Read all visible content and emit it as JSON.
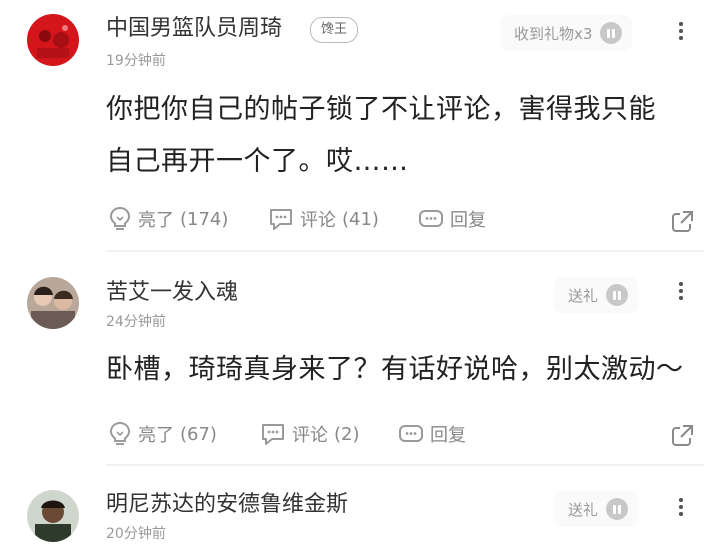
{
  "comments": [
    {
      "username": "中国男篮队员周琦",
      "badge": "馋王",
      "timestamp": "19分钟前",
      "gift_label": "收到礼物x3",
      "body_lines": [
        "你把你自己的帖子锁了不让评论，害得我只能",
        "自己再开一个了。哎……"
      ],
      "likes_label": "亮了",
      "likes_count": "(174)",
      "comments_label": "评论",
      "comments_count": "(41)",
      "reply_label": "回复"
    },
    {
      "username": "苦艾一发入魂",
      "timestamp": "24分钟前",
      "gift_label": "送礼",
      "body_lines": [
        "卧槽，琦琦真身来了？有话好说哈，别太激动～"
      ],
      "likes_label": "亮了",
      "likes_count": "(67)",
      "comments_label": "评论",
      "comments_count": "(2)",
      "reply_label": "回复"
    },
    {
      "username": "明尼苏达的安德鲁维金斯",
      "timestamp": "20分钟前",
      "gift_label": "送礼"
    }
  ],
  "colors": {
    "text_primary": "#222222",
    "text_secondary": "#888888",
    "timestamp": "#999999",
    "avatar_red": "#d4151b"
  },
  "icons": [
    "lightbulb-icon",
    "comment-bubble-icon",
    "reply-chat-icon",
    "share-icon",
    "more-vertical-icon",
    "gift-icon"
  ]
}
